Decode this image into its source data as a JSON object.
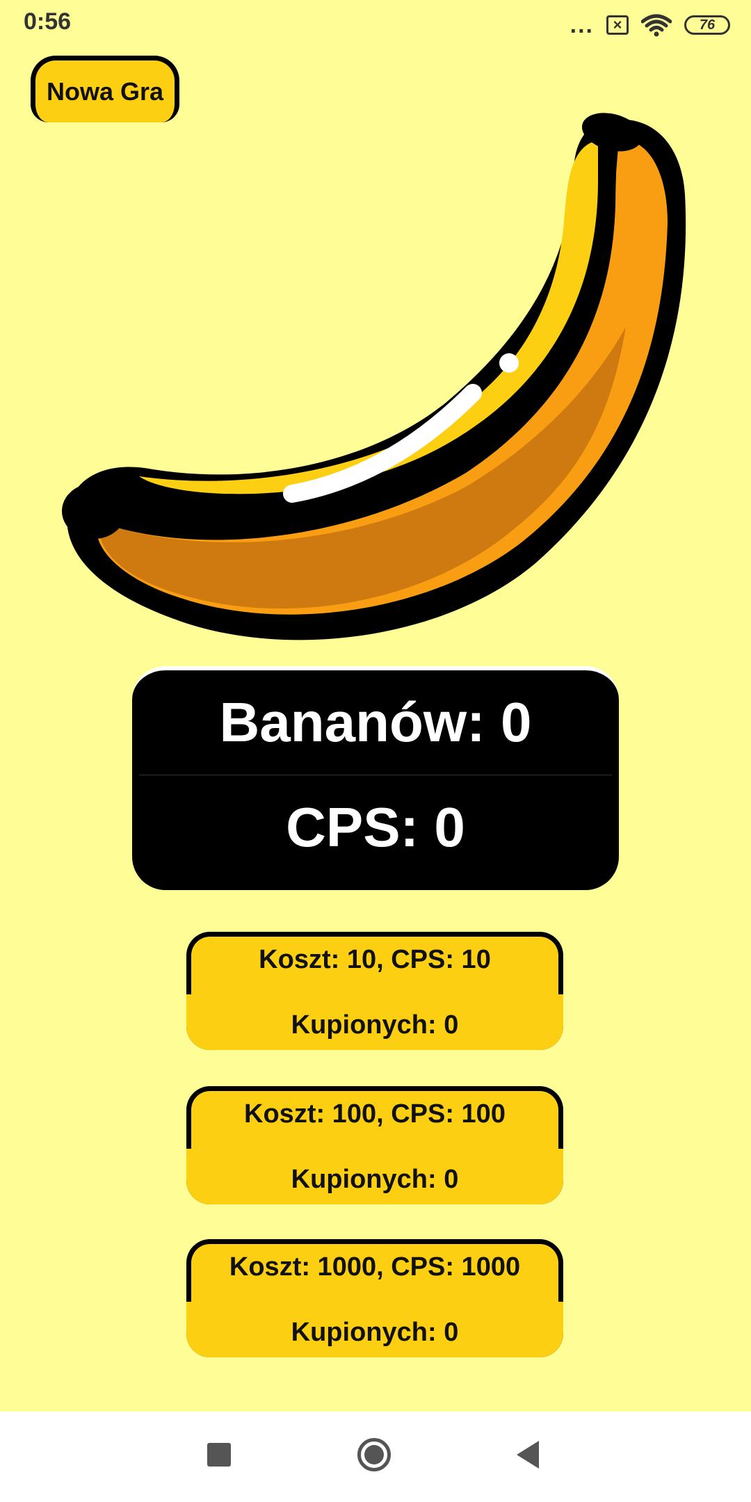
{
  "status_bar": {
    "time": "0:56",
    "dots": "...",
    "sim_icon": "×",
    "battery": "76"
  },
  "header": {
    "new_game_label": "Nowa Gra"
  },
  "banana": {
    "icon": "banana-icon"
  },
  "score": {
    "bananas": "Bananów: 0",
    "cps": "CPS: 0"
  },
  "upgrades": [
    {
      "cost": "Koszt: 10, CPS: 10",
      "owned": "Kupionych: 0"
    },
    {
      "cost": "Koszt: 100, CPS: 100",
      "owned": "Kupionych: 0"
    },
    {
      "cost": "Koszt: 1000, CPS: 1000",
      "owned": "Kupionych: 0"
    }
  ],
  "colors": {
    "background": "#FFFD96",
    "accent": "#FCCF12",
    "panel": "#000000"
  }
}
